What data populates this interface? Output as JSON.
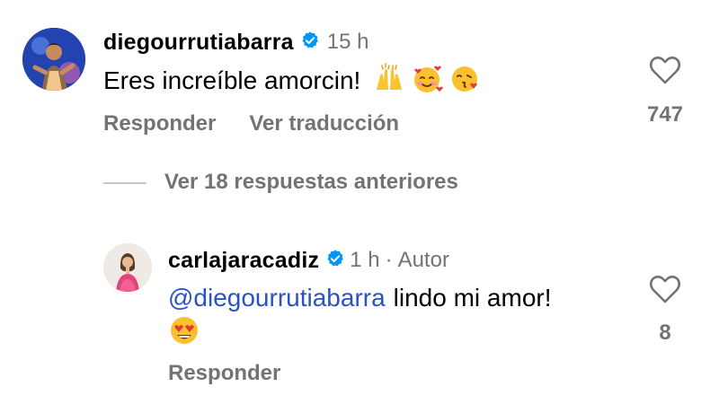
{
  "comments": [
    {
      "username": "diegourrutiabarra",
      "time": "15 h",
      "text": "Eres increíble amorcin!",
      "emojis": [
        "raising-hands",
        "smiling-face-with-hearts",
        "face-blowing-kiss"
      ],
      "reply_label": "Responder",
      "translate_label": "Ver traducción",
      "like_count": "747"
    }
  ],
  "view_replies_label": "Ver 18 respuestas anteriores",
  "reply": {
    "username": "carlajaracadiz",
    "time": "1 h",
    "separator": "·",
    "author_badge": "Autor",
    "mention": "@diegourrutiabarra",
    "text": "lindo mi amor!",
    "emojis": [
      "smiling-face-with-heart-eyes"
    ],
    "reply_label": "Responder",
    "like_count": "8"
  },
  "colors": {
    "muted": "#737373",
    "mention": "#2a51c8",
    "verified": "#0095f6"
  }
}
